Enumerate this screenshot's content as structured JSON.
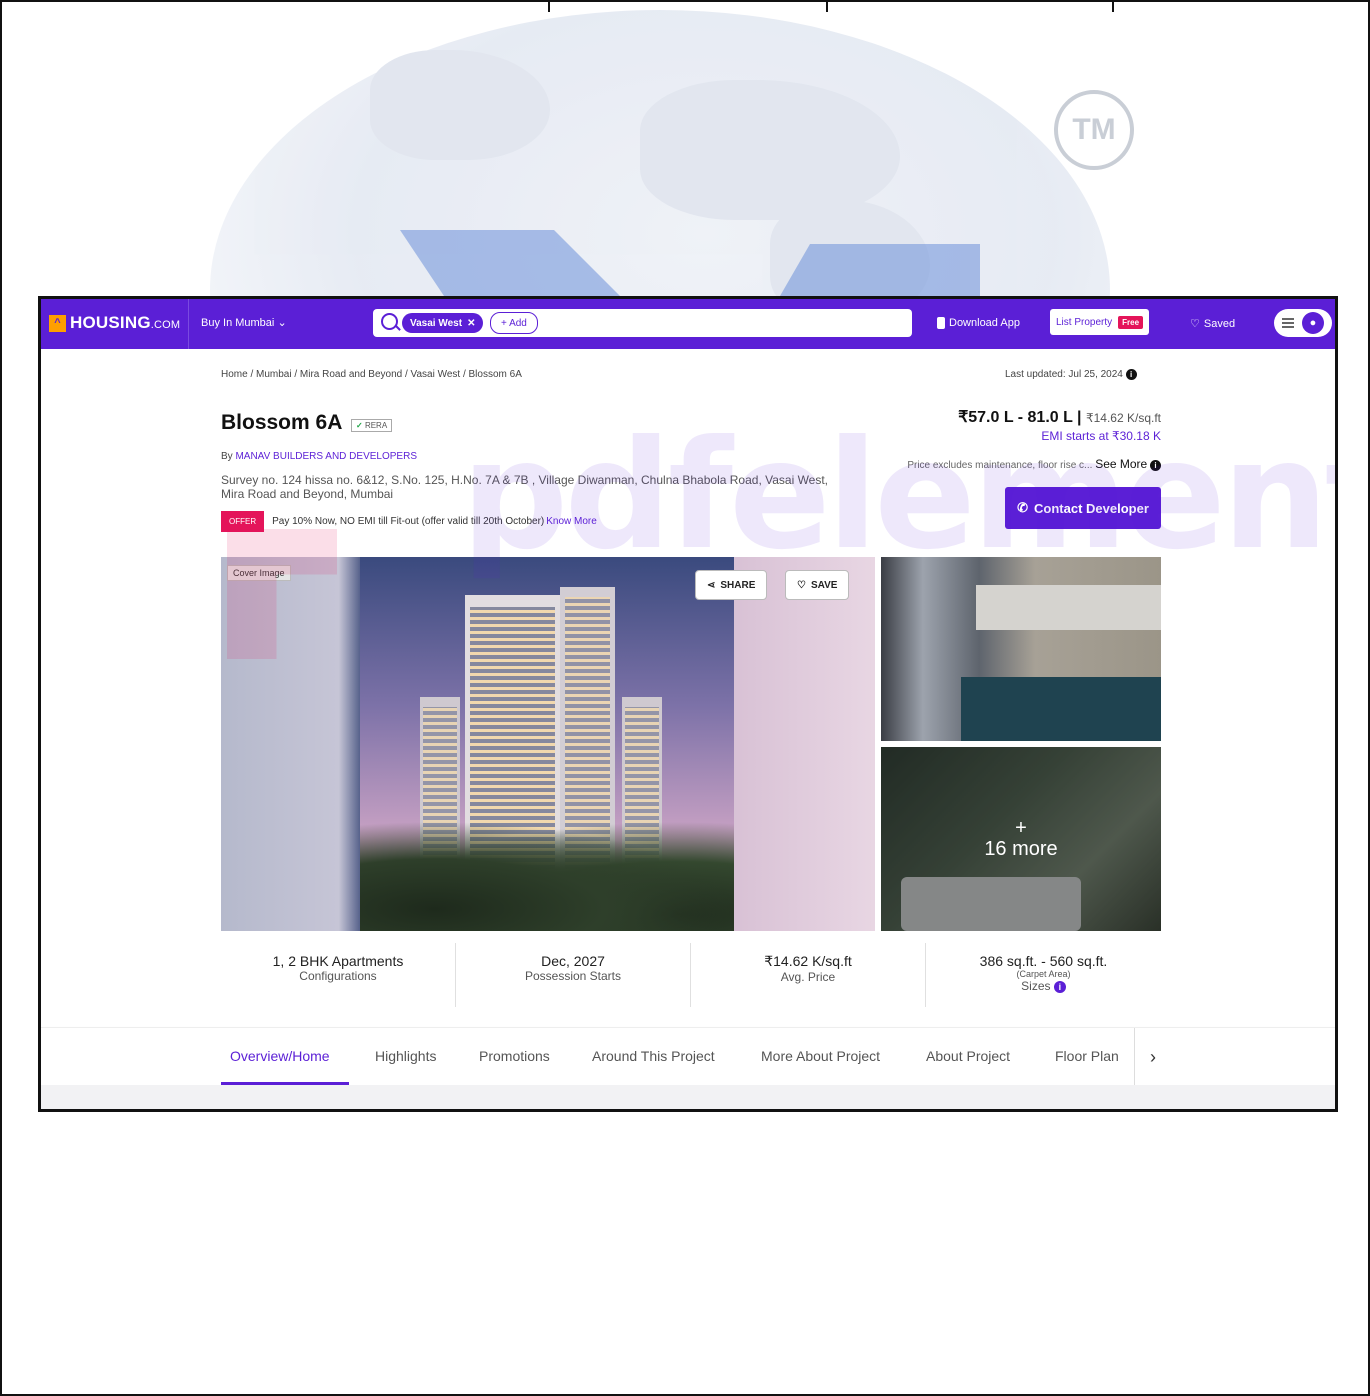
{
  "watermark": {
    "tm": "TM",
    "brand": "pdfelement"
  },
  "navbar": {
    "logo_icon": "^",
    "logo": "HOUSING",
    "logo_suffix": "COM",
    "location": "Buy In Mumbai",
    "search_chip": "Vasai West",
    "search_add": "+ Add",
    "download_app": "Download App",
    "list_property": "List Property",
    "free_badge": "Free",
    "saved": "Saved"
  },
  "breadcrumb": "Home / Mumbai / Mira Road and Beyond / Vasai West / Blossom 6A",
  "last_updated": "Last updated: Jul 25, 2024",
  "project": {
    "name": "Blossom 6A",
    "rera": "RERA",
    "builder_prefix": "By",
    "builder": "MANAV BUILDERS AND DEVELOPERS",
    "address": "Survey no. 124 hissa no. 6&12, S.No. 125, H.No. 7A & 7B , Village Diwanman, Chulna Bhabola Road, Vasai West, Mira Road and Beyond, Mumbai",
    "offer_tag": "OFFER",
    "offer_text": "Pay 10% Now, NO EMI till Fit-out (offer valid till 20th October)",
    "offer_link": "Know More"
  },
  "pricing": {
    "range": "₹57.0 L - 81.0 L",
    "per_sqft": "₹14.62 K/sq.ft",
    "emi": "EMI starts at ₹30.18 K",
    "note": "Price excludes maintenance, floor rise c...",
    "see_more": "See More",
    "contact_button": "Contact Developer"
  },
  "gallery": {
    "cover_label": "Cover Image",
    "share_label": "SHARE",
    "save_label": "SAVE",
    "more_plus": "+",
    "more_count": "16 more"
  },
  "stats": [
    {
      "value": "1, 2 BHK Apartments",
      "label": "Configurations"
    },
    {
      "value": "Dec, 2027",
      "label": "Possession Starts"
    },
    {
      "value": "₹14.62 K/sq.ft",
      "label": "Avg. Price"
    },
    {
      "value": "386 sq.ft. - 560 sq.ft.",
      "sub": "(Carpet Area)",
      "label": "Sizes"
    }
  ],
  "tabs": [
    "Overview/Home",
    "Highlights",
    "Promotions",
    "Around This Project",
    "More About Project",
    "About Project",
    "Floor Plan"
  ],
  "tab_next": "›",
  "accent": "#5b1fd6"
}
